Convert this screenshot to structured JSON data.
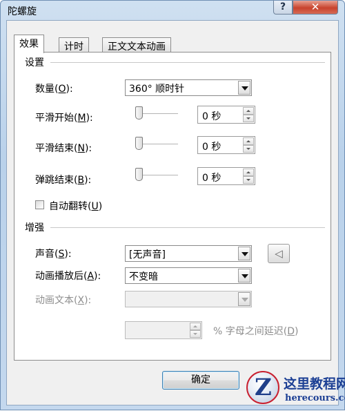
{
  "window": {
    "title": "陀螺旋",
    "help_label": "?",
    "close_label": "✕"
  },
  "tabs": [
    {
      "label": "效果",
      "active": true
    },
    {
      "label": "计时",
      "active": false
    },
    {
      "label": "正文文本动画",
      "active": false
    }
  ],
  "settings": {
    "section_title": "设置",
    "amount": {
      "label": "数量(",
      "accel": "O",
      "suffix": "):",
      "value": "360°  顺时针"
    },
    "smooth_start": {
      "label": "平滑开始(",
      "accel": "M",
      "suffix": "):",
      "value": "0 秒",
      "slider_level": 0
    },
    "smooth_end": {
      "label": "平滑结束(",
      "accel": "N",
      "suffix": "):",
      "value": "0 秒",
      "slider_level": 0
    },
    "bounce_end": {
      "label": "弹跳结束(",
      "accel": "B",
      "suffix": "):",
      "value": "0 秒",
      "slider_level": 0
    },
    "auto_reverse": {
      "label": "自动翻转(",
      "accel": "U",
      "suffix": ")",
      "checked": false
    }
  },
  "enhancements": {
    "section_title": "增强",
    "sound": {
      "label": "声音(",
      "accel": "S",
      "suffix": "):",
      "value": "[无声音]",
      "icon": "speaker-icon"
    },
    "after_animation": {
      "label": "动画播放后(",
      "accel": "A",
      "suffix": "):",
      "value": "不变暗"
    },
    "animate_text": {
      "label": "动画文本(",
      "accel": "X",
      "suffix": "):",
      "value": "",
      "disabled": true
    },
    "delay": {
      "value": "",
      "label": "% 字母之间延迟(",
      "accel": "D",
      "suffix": ")",
      "disabled": true
    }
  },
  "buttons": {
    "ok": "确定"
  },
  "watermark": {
    "logo_letter": "Z",
    "name": "这里教程网",
    "site": "herecours.com"
  },
  "colors": {
    "titlebar": "#c4d8ee",
    "close_button": "#c8432d",
    "ok_border": "#3c7fb1",
    "logo_blue": "#1c3f94",
    "logo_red": "#c9202f"
  }
}
